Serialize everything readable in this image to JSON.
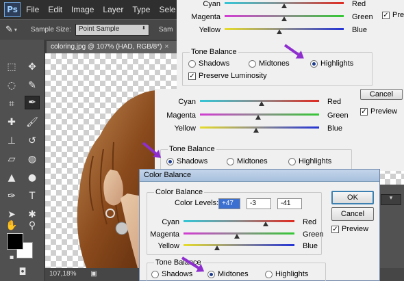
{
  "app": {
    "logo": "Ps"
  },
  "menu": [
    "File",
    "Edit",
    "Image",
    "Layer",
    "Type",
    "Sele"
  ],
  "options_bar": {
    "sample_size_label": "Sample Size:",
    "sample_size_value": "Point Sample",
    "sample_label": "Sam"
  },
  "document": {
    "tab_title": "coloring.jpg @ 107% (HAD, RGB/8*)",
    "tab_close": "×"
  },
  "status": {
    "zoom": "107,18%"
  },
  "dialog_back": {
    "sliders": [
      {
        "left": "Cyan",
        "right": "Red",
        "value": 0
      },
      {
        "left": "Magenta",
        "right": "Green",
        "value": 0
      },
      {
        "left": "Yellow",
        "right": "Blue",
        "value": -8
      }
    ],
    "tone_balance_title": "Tone Balance",
    "tones": [
      "Shadows",
      "Midtones",
      "Highlights"
    ],
    "selected_tone": "Highlights",
    "preserve_label": "Preserve Luminosity",
    "preview_label": "Previ"
  },
  "dialog_mid": {
    "sliders": [
      {
        "left": "Cyan",
        "right": "Red",
        "value": 0
      },
      {
        "left": "Magenta",
        "right": "Green",
        "value": -2
      },
      {
        "left": "Yellow",
        "right": "Blue",
        "value": -6
      }
    ],
    "tone_balance_title": "Tone Balance",
    "tones": [
      "Shadows",
      "Midtones",
      "Highlights"
    ],
    "selected_tone": "Shadows",
    "cancel_label": "Cancel",
    "preview_label": "Preview"
  },
  "dialog_front": {
    "title": "Color Balance",
    "color_balance_title": "Color Balance",
    "color_levels_label": "Color Levels:",
    "levels": [
      "+47",
      "-3",
      "-41"
    ],
    "sliders": [
      {
        "left": "Cyan",
        "right": "Red",
        "value": 47
      },
      {
        "left": "Magenta",
        "right": "Green",
        "value": -3
      },
      {
        "left": "Yellow",
        "right": "Blue",
        "value": -41
      }
    ],
    "tone_balance_title": "Tone Balance",
    "tones": [
      "Shadows",
      "Midtones",
      "Highlights"
    ],
    "selected_tone": "Midtones",
    "ok_label": "OK",
    "cancel_label": "Cancel",
    "preview_label": "Preview"
  },
  "colors": {
    "arrow": "#8e2ecf",
    "photo_tone": "#8a4a1c"
  }
}
